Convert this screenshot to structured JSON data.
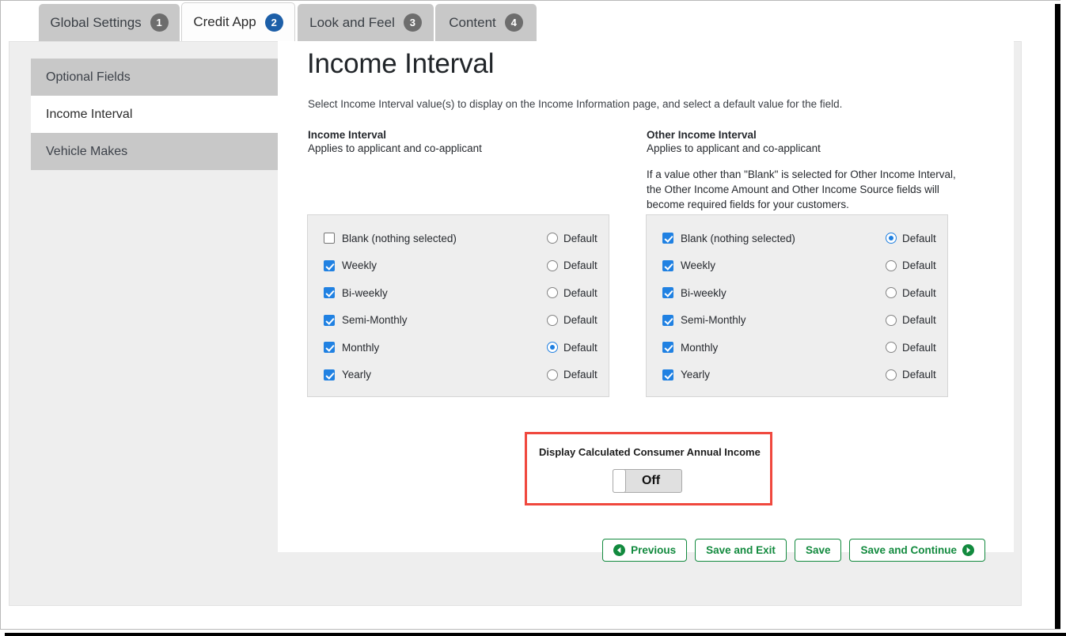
{
  "tabs": [
    {
      "label": "Global Settings",
      "number": "1",
      "active": false
    },
    {
      "label": "Credit App",
      "number": "2",
      "active": true
    },
    {
      "label": "Look and Feel",
      "number": "3",
      "active": false
    },
    {
      "label": "Content",
      "number": "4",
      "active": false
    }
  ],
  "sidebar": {
    "items": [
      {
        "label": "Optional Fields",
        "active": false
      },
      {
        "label": "Income Interval",
        "active": true
      },
      {
        "label": "Vehicle Makes",
        "active": false
      }
    ]
  },
  "main": {
    "title": "Income Interval",
    "subtitle": "Select Income Interval value(s) to display on the Income Information page, and select a default value for the field.",
    "left_column": {
      "title": "Income Interval",
      "subtitle": "Applies to applicant and co-applicant",
      "note": "",
      "rows": [
        {
          "label": "Blank (nothing selected)",
          "checked": false,
          "default": false
        },
        {
          "label": "Weekly",
          "checked": true,
          "default": false
        },
        {
          "label": "Bi-weekly",
          "checked": true,
          "default": false
        },
        {
          "label": "Semi-Monthly",
          "checked": true,
          "default": false
        },
        {
          "label": "Monthly",
          "checked": true,
          "default": true
        },
        {
          "label": "Yearly",
          "checked": true,
          "default": false
        }
      ],
      "default_label": "Default"
    },
    "right_column": {
      "title": "Other Income Interval",
      "subtitle": "Applies to applicant and co-applicant",
      "note": "If a value other than \"Blank\" is selected for Other Income Interval, the Other Income Amount and Other Income Source fields will become required fields for your customers.",
      "rows": [
        {
          "label": "Blank (nothing selected)",
          "checked": true,
          "default": true
        },
        {
          "label": "Weekly",
          "checked": true,
          "default": false
        },
        {
          "label": "Bi-weekly",
          "checked": true,
          "default": false
        },
        {
          "label": "Semi-Monthly",
          "checked": true,
          "default": false
        },
        {
          "label": "Monthly",
          "checked": true,
          "default": false
        },
        {
          "label": "Yearly",
          "checked": true,
          "default": false
        }
      ],
      "default_label": "Default"
    },
    "toggle_section": {
      "caption": "Display Calculated Consumer Annual Income",
      "state": "Off",
      "highlight_color": "#f0483e"
    },
    "buttons": [
      {
        "label": "Previous",
        "icon": "arrow-left-circle-icon"
      },
      {
        "label": "Save and Exit",
        "icon": ""
      },
      {
        "label": "Save",
        "icon": ""
      },
      {
        "label": "Save and Continue",
        "icon": "arrow-right-circle-icon"
      }
    ]
  },
  "colors": {
    "accent_blue": "#1d5fa8",
    "checkbox_blue": "#2081e2",
    "button_green": "#128a3e",
    "badge_gray": "#6d6d6d"
  }
}
